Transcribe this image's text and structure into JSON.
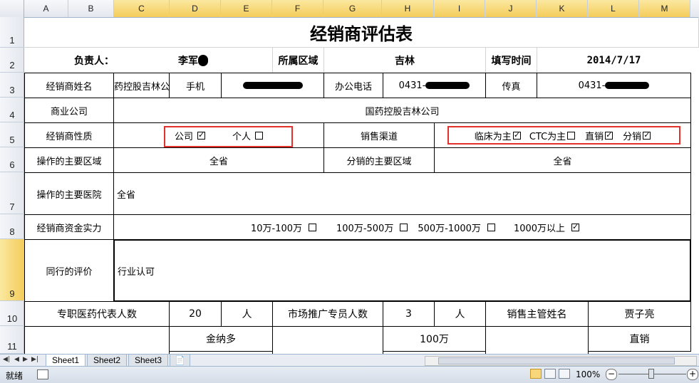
{
  "columns": [
    "A",
    "B",
    "C",
    "D",
    "E",
    "F",
    "G",
    "H",
    "I",
    "J",
    "K",
    "L",
    "M"
  ],
  "rows": [
    "1",
    "2",
    "3",
    "4",
    "5",
    "6",
    "7",
    "8",
    "9",
    "10",
    "11"
  ],
  "selected_row": "9",
  "sheet": {
    "title": "经销商评估表",
    "r2": {
      "owner_label": "负责人：",
      "owner_value": "李军",
      "region_label": "所属区域",
      "region_value": "吉林",
      "date_label": "填写时间",
      "date_value": "2014/7/17"
    },
    "r3": {
      "name_label": "经销商姓名",
      "name_value": "药控股吉林公",
      "mobile_label": "手机",
      "office_label": "办公电话",
      "office_value": "0431-",
      "fax_label": "传真",
      "fax_value": "0431-"
    },
    "r4": {
      "label": "商业公司",
      "value": "国药控股吉林公司"
    },
    "r5": {
      "label": "经销商性质",
      "nature": [
        {
          "text": "公司",
          "checked": true
        },
        {
          "text": "个人",
          "checked": false
        }
      ],
      "channel_label": "销售渠道",
      "channels": [
        {
          "text": "临床为主",
          "checked": true
        },
        {
          "text": "CTC为主",
          "checked": false
        },
        {
          "text": "直销",
          "checked": true
        },
        {
          "text": "分销",
          "checked": true
        }
      ]
    },
    "r6": {
      "op_area_label": "操作的主要区域",
      "op_area_value": "全省",
      "dist_area_label": "分销的主要区域",
      "dist_area_value": "全省"
    },
    "r7": {
      "label": "操作的主要医院",
      "value": "全省"
    },
    "r8": {
      "label": "经销商资金实力",
      "options": [
        {
          "text": "10万-100万",
          "checked": false
        },
        {
          "text": "100万-500万",
          "checked": false
        },
        {
          "text": "500万-1000万",
          "checked": false
        },
        {
          "text": "1000万以上",
          "checked": true
        }
      ]
    },
    "r9": {
      "label": "同行的评价",
      "value": "行业认可"
    },
    "r10": {
      "reps_label": "专职医药代表人数",
      "reps_value": "20",
      "reps_unit": "人",
      "promo_label": "市场推广专员人数",
      "promo_value": "3",
      "promo_unit": "人",
      "mgr_label": "销售主管姓名",
      "mgr_value": "贾子亮"
    },
    "r11": {
      "d": "金纳多",
      "h": "100万",
      "l": "直销"
    }
  },
  "tabs": [
    "Sheet1",
    "Sheet2",
    "Sheet3"
  ],
  "active_tab": "Sheet1",
  "status": {
    "ready": "就绪",
    "zoom": "100%"
  },
  "colors": {
    "redbox": "#e0312b",
    "header_selected": "#f4cc5a"
  }
}
